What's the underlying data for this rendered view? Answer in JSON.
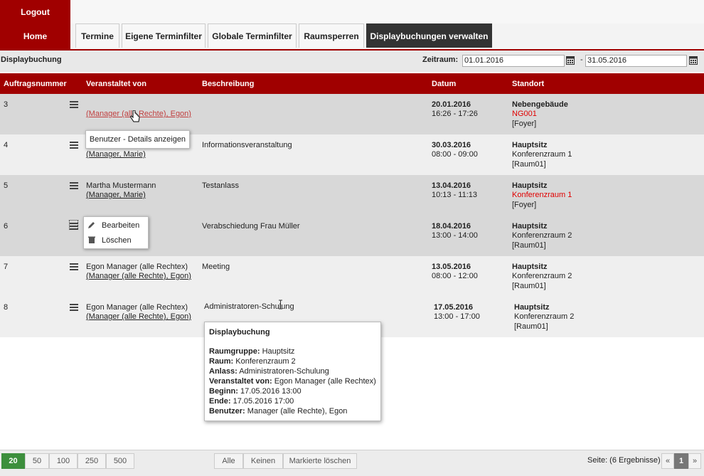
{
  "top": {
    "logout_label": "Logout",
    "home_label": "Home"
  },
  "tabs": [
    {
      "label": "Termine"
    },
    {
      "label": "Eigene Terminfilter"
    },
    {
      "label": "Globale Terminfilter"
    },
    {
      "label": "Raumsperren"
    },
    {
      "label": "Displaybuchungen verwalten"
    }
  ],
  "subheader": {
    "title": "Displaybuchung",
    "zeitraum_label": "Zeitraum:",
    "date_from": "01.01.2016",
    "date_separator": "-",
    "date_to": "31.05.2016"
  },
  "table": {
    "headers": [
      "Auftragsnummer",
      "Veranstaltet von",
      "Beschreibung",
      "Datum",
      "Standort"
    ],
    "rows": [
      {
        "nr": "3",
        "veranst_name": "",
        "veranst_user": "(Manager (alle Rechte), Egon)",
        "beschreibung": "",
        "datum": "20.01.2016",
        "zeit": "16:26 - 17:26",
        "standort": "Nebengebäude",
        "raum": "NG001",
        "raum2": "[Foyer]"
      },
      {
        "nr": "4",
        "veranst_name": "",
        "veranst_user": "(Manager, Marie)",
        "beschreibung": "Informationsveranstaltung",
        "datum": "30.03.2016",
        "zeit": "08:00 - 09:00",
        "standort": "Hauptsitz",
        "raum": "Konferenzraum 1",
        "raum2": "[Raum01]"
      },
      {
        "nr": "5",
        "veranst_name": "Martha Mustermann",
        "veranst_user": "(Manager, Marie)",
        "beschreibung": "Testanlass",
        "datum": "13.04.2016",
        "zeit": "10:13 - 11:13",
        "standort": "Hauptsitz",
        "raum": "Konferenzraum 1",
        "raum2": "[Foyer]"
      },
      {
        "nr": "6",
        "veranst_name": "",
        "veranst_user": "",
        "beschreibung": "Verabschiedung Frau Müller",
        "datum": "18.04.2016",
        "zeit": "13:00 - 14:00",
        "standort": "Hauptsitz",
        "raum": "Konferenzraum 2",
        "raum2": "[Raum01]"
      },
      {
        "nr": "7",
        "veranst_name": "Egon Manager (alle Rechtex)",
        "veranst_user": "(Manager (alle Rechte), Egon)",
        "beschreibung": "Meeting",
        "datum": "13.05.2016",
        "zeit": "08:00 - 12:00",
        "standort": "Hauptsitz",
        "raum": "Konferenzraum 2",
        "raum2": "[Raum01]"
      },
      {
        "nr": "8",
        "veranst_name": "Egon Manager (alle Rechtex)",
        "veranst_user": "(Manager (alle Rechte), Egon)",
        "beschreibung": "Administratoren-Schulung",
        "datum": "17.05.2016",
        "zeit": "13:00 - 17:00",
        "standort": "Hauptsitz",
        "raum": "Konferenzraum 2",
        "raum2": "[Raum01]"
      }
    ]
  },
  "tooltip": {
    "user_details": "Benutzer - Details anzeigen"
  },
  "context_menu": {
    "edit_label": "Bearbeiten",
    "delete_label": "Löschen"
  },
  "info_popup": {
    "title": "Displaybuchung",
    "lines": [
      {
        "key": "Raumgruppe:",
        "value": "Hauptsitz"
      },
      {
        "key": "Raum:",
        "value": "Konferenzraum 2"
      },
      {
        "key": "Anlass:",
        "value": "Administratoren-Schulung"
      },
      {
        "key": "Veranstaltet von:",
        "value": "Egon Manager (alle Rechtex)"
      },
      {
        "key": "Beginn:",
        "value": "17.05.2016 13:00"
      },
      {
        "key": "Ende:",
        "value": "17.05.2016 17:00"
      },
      {
        "key": "Benutzer:",
        "value": "Manager (alle Rechte), Egon"
      }
    ]
  },
  "footer": {
    "page_sizes": [
      "20",
      "50",
      "100",
      "250",
      "500"
    ],
    "active_page_size": "20",
    "select_all": "Alle",
    "select_none": "Keinen",
    "delete_marked": "Markierte löschen",
    "pages_label": "Seite: (6 Ergebnisse)",
    "prev": "«",
    "current_page": "1",
    "next": "»"
  },
  "colors": {
    "brand": "#a00000",
    "active_tab": "#333333",
    "page_size_active": "#3d8f3d",
    "highlight_red": "#e00000"
  }
}
